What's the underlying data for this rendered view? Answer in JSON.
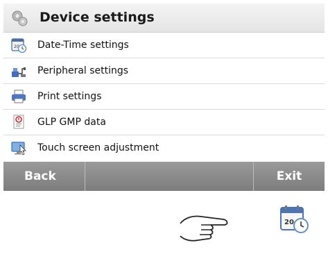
{
  "header": {
    "title": "Device settings",
    "icon": "gears-icon"
  },
  "menu": {
    "items": [
      {
        "label": "Date-Time settings",
        "icon": "date-time-icon"
      },
      {
        "label": "Peripheral settings",
        "icon": "peripheral-icon"
      },
      {
        "label": "Print settings",
        "icon": "printer-icon"
      },
      {
        "label": "GLP GMP data",
        "icon": "glp-gmp-icon"
      },
      {
        "label": "Touch screen adjustment",
        "icon": "touch-screen-icon"
      }
    ]
  },
  "footer": {
    "back_label": "Back",
    "exit_label": "Exit"
  },
  "gesture": {
    "icon": "pointing-hand-icon"
  },
  "result_icon": {
    "icon": "calendar-clock-icon",
    "day_text": "20"
  }
}
